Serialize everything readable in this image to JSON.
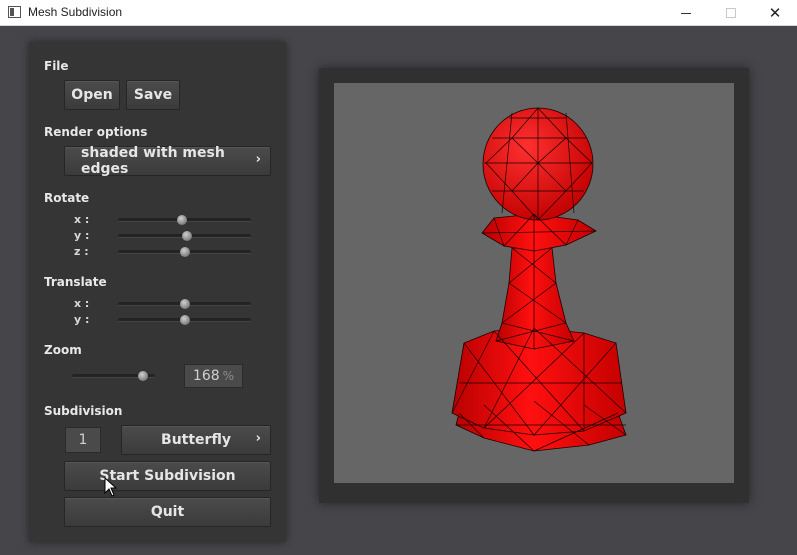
{
  "window": {
    "title": "Mesh Subdivision",
    "close_glyph": "✕"
  },
  "panel": {
    "file": {
      "label": "File",
      "open_label": "Open",
      "save_label": "Save"
    },
    "render": {
      "label": "Render options",
      "mode": "shaded with mesh edges",
      "chevron": "›"
    },
    "rotate": {
      "label": "Rotate",
      "x_label": "x :",
      "y_label": "y :",
      "z_label": "z :",
      "x_value": 0.48,
      "y_value": 0.52,
      "z_value": 0.5
    },
    "translate": {
      "label": "Translate",
      "x_label": "x :",
      "y_label": "y :",
      "x_value": 0.5,
      "y_value": 0.5
    },
    "zoom": {
      "label": "Zoom",
      "value": "168",
      "unit": "%",
      "slider_value": 0.85
    },
    "subdivision": {
      "label": "Subdivision",
      "level": "1",
      "method": "Butterfly",
      "chevron": "›",
      "start_label": "Start Subdivision",
      "quit_label": "Quit"
    }
  },
  "viewport": {
    "model": "pawn-mesh",
    "background": "#666666",
    "mesh_color": "#ff0000",
    "edge_color": "#1a0000"
  }
}
